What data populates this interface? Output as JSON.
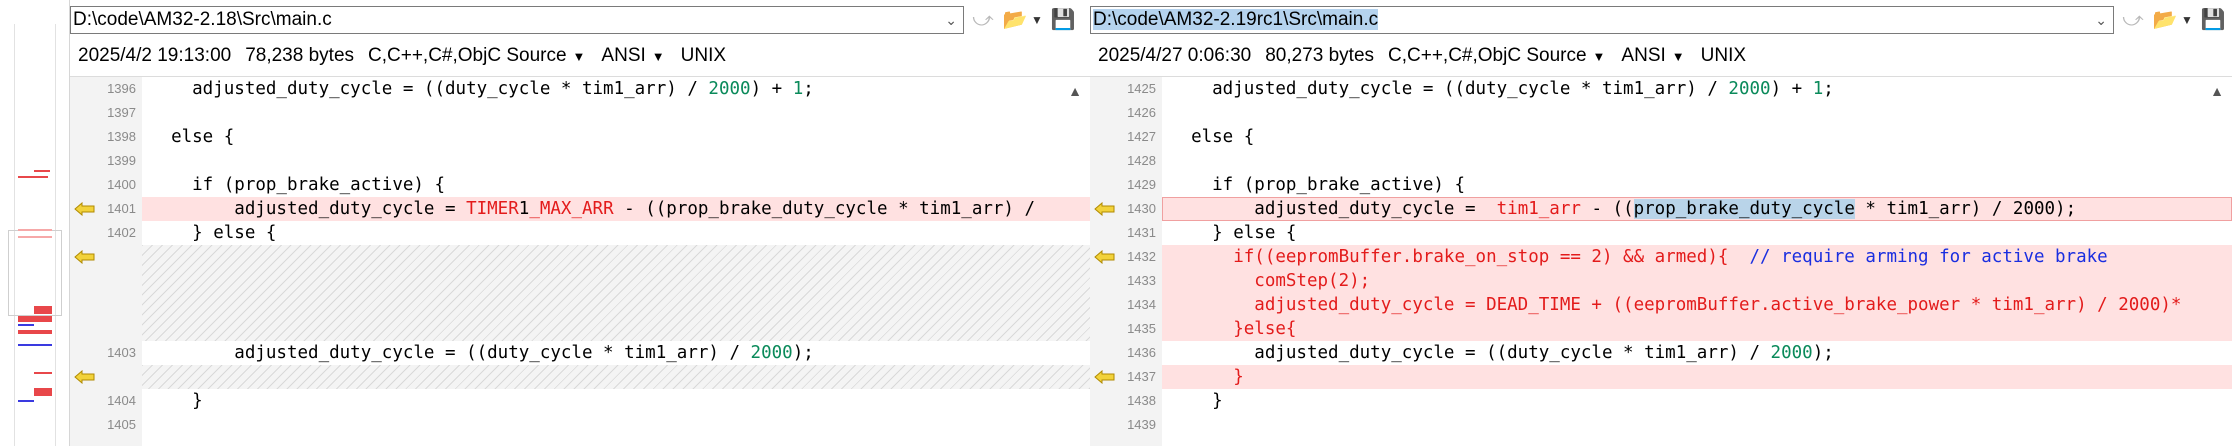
{
  "left": {
    "path": "D:\\code\\AM32-2.18\\Src\\main.c",
    "date": "2025/4/2 19:13:00",
    "size": "78,238 bytes",
    "format": "C,C++,C#,ObjC Source",
    "encoding": "ANSI",
    "eol": "UNIX",
    "lines": [
      {
        "n": "1396",
        "parts": [
          {
            "t": "    adjusted_duty_cycle = ((duty_cycle * tim1_arr) / "
          },
          {
            "t": "2000",
            "c": "num"
          },
          {
            "t": ") + "
          },
          {
            "t": "1",
            "c": "num"
          },
          {
            "t": ";"
          }
        ]
      },
      {
        "n": "1397",
        "parts": [
          {
            "t": ""
          }
        ]
      },
      {
        "n": "1398",
        "parts": [
          {
            "t": "  else {"
          }
        ]
      },
      {
        "n": "1399",
        "parts": [
          {
            "t": ""
          }
        ]
      },
      {
        "n": "1400",
        "parts": [
          {
            "t": "    if (prop_brake_active) {"
          }
        ]
      },
      {
        "n": "1401",
        "changed": true,
        "arrow": true,
        "parts": [
          {
            "t": "        adjusted_duty_cycle = "
          },
          {
            "t": "TIMER",
            "c": "red"
          },
          {
            "t": "1"
          },
          {
            "t": "_MAX_ARR",
            "c": "red"
          },
          {
            "t": " - ((prop_brake_duty_cycle * tim1_arr) /"
          }
        ]
      },
      {
        "n": "1402",
        "parts": [
          {
            "t": "    } else {"
          }
        ]
      },
      {
        "n": "1403",
        "parts": [
          {
            "t": "        adjusted_duty_cycle = ((duty_cycle * tim1_arr) / "
          },
          {
            "t": "2000",
            "c": "num"
          },
          {
            "t": ");"
          }
        ]
      },
      {
        "n": "1404",
        "parts": [
          {
            "t": "    }"
          }
        ]
      },
      {
        "n": "1405",
        "parts": [
          {
            "t": ""
          }
        ]
      }
    ]
  },
  "right": {
    "path": "D:\\code\\AM32-2.19rc1\\Src\\main.c",
    "date": "2025/4/27 0:06:30",
    "size": "80,273 bytes",
    "format": "C,C++,C#,ObjC Source",
    "encoding": "ANSI",
    "eol": "UNIX",
    "lines": [
      {
        "n": "1425",
        "parts": [
          {
            "t": "    adjusted_duty_cycle = ((duty_cycle * tim1_arr) / "
          },
          {
            "t": "2000",
            "c": "num"
          },
          {
            "t": ") + "
          },
          {
            "t": "1",
            "c": "num"
          },
          {
            "t": ";"
          }
        ]
      },
      {
        "n": "1426",
        "parts": [
          {
            "t": ""
          }
        ]
      },
      {
        "n": "1427",
        "parts": [
          {
            "t": "  else {"
          }
        ]
      },
      {
        "n": "1428",
        "parts": [
          {
            "t": ""
          }
        ]
      },
      {
        "n": "1429",
        "parts": [
          {
            "t": "    if (prop_brake_active) {"
          }
        ]
      },
      {
        "n": "1430",
        "changed": true,
        "outline": true,
        "arrow": true,
        "parts": [
          {
            "t": "        adjusted_duty_cycle =  "
          },
          {
            "t": "tim1_arr",
            "c": "red"
          },
          {
            "t": " - (("
          },
          {
            "t": "prop_brake_duty_cycle",
            "c": "hl"
          },
          {
            "t": " * tim1_arr) / 2000);"
          }
        ]
      },
      {
        "n": "1431",
        "parts": [
          {
            "t": "    } else {"
          }
        ]
      },
      {
        "n": "1432",
        "changed": true,
        "arrow": true,
        "parts": [
          {
            "t": "      if((eepromBuffer.brake_on_stop == 2) && armed){  ",
            "c": "redtx"
          },
          {
            "t": "// require arming for active brake",
            "c": "cmt"
          }
        ]
      },
      {
        "n": "1433",
        "changed": true,
        "parts": [
          {
            "t": "        comStep(2);",
            "c": "redtx"
          }
        ]
      },
      {
        "n": "1434",
        "changed": true,
        "parts": [
          {
            "t": "        adjusted_duty_cycle = DEAD_TIME + ((eepromBuffer.active_brake_power * tim1_arr) / 2000)*",
            "c": "redtx"
          }
        ]
      },
      {
        "n": "1435",
        "changed": true,
        "parts": [
          {
            "t": "      }else{",
            "c": "redtx"
          }
        ]
      },
      {
        "n": "1436",
        "parts": [
          {
            "t": "        adjusted_duty_cycle = ((duty_cycle * tim1_arr) / "
          },
          {
            "t": "2000",
            "c": "num"
          },
          {
            "t": ");"
          }
        ]
      },
      {
        "n": "1437",
        "changed": true,
        "arrow": true,
        "parts": [
          {
            "t": "      }",
            "c": "redtx"
          }
        ]
      },
      {
        "n": "1438",
        "parts": [
          {
            "t": "    }"
          }
        ]
      },
      {
        "n": "1439",
        "parts": [
          {
            "t": ""
          }
        ]
      }
    ]
  },
  "icons": {
    "dropdown": "chevron-down-icon",
    "next": "next-diff-icon",
    "folder": "folder-open-icon",
    "save": "save-icon",
    "arrow": "change-arrow-icon",
    "scroll": "scroll-up-icon"
  },
  "colors": {
    "changed_bg": "#ffe1e1",
    "red_text": "#e31b1b",
    "number": "#0a8a5a",
    "comment": "#1a2ee0",
    "selection": "#b5d3ee",
    "arrow": "#c9a400"
  }
}
